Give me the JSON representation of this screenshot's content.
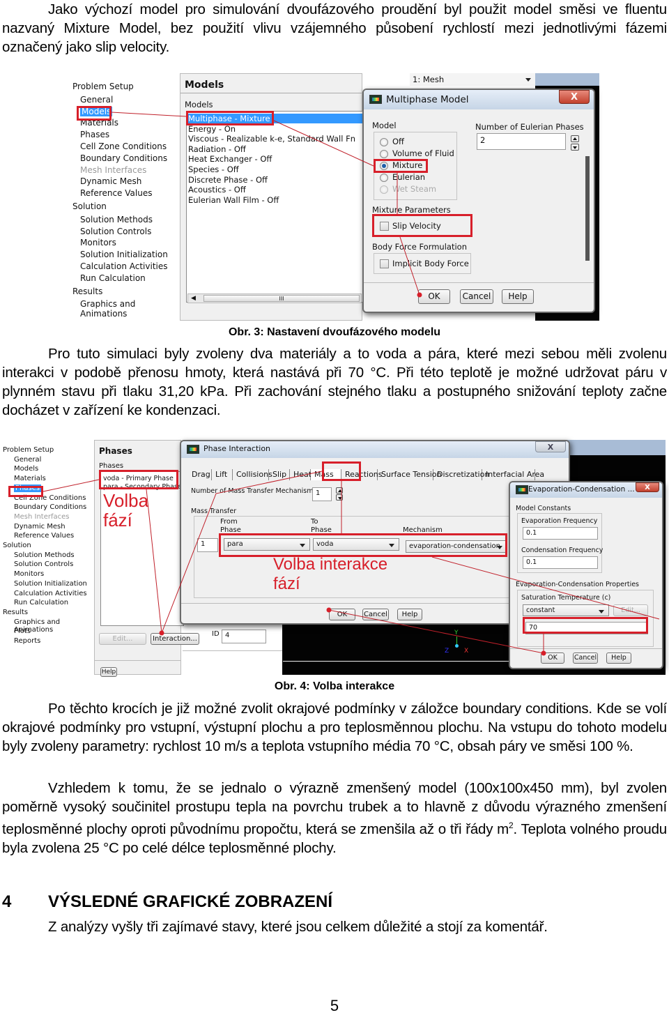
{
  "paragraphs": {
    "p1": "Jako výchozí model pro simulování dvoufázového proudění byl použit model směsi ve fluentu nazvaný Mixture Model, bez použití vlivu vzájemného působení rychlostí mezi jednotlivými fázemi označený jako slip velocity.",
    "p2": "Pro tuto simulaci byly zvoleny dva materiály a to voda a pára, které mezi sebou měli zvolenu interakci v podobě přenosu hmoty, která nastává při 70 °C. Při této teplotě je možné udržovat páru v plynném stavu při tlaku 31,20 kPa. Při zachování stejného tlaku a postupného snižování teploty začne docházet v zařízení ke kondenzaci.",
    "p3": "Po těchto krocích je již možné zvolit okrajové podmínky v záložce boundary conditions. Kde se volí okrajové podmínky pro vstupní, výstupní plochu a pro teplosměnnou plochu. Na vstupu do tohoto modelu byly zvoleny parametry: rychlost 10 m/s a teplota vstupního média 70 °C, obsah páry ve směsi 100 %.",
    "p4_before_sup": "Vzhledem k tomu, že se jednalo o výrazně zmenšený model (100x100x450 mm), byl zvolen poměrně vysoký součinitel prostupu tepla na povrchu trubek a to hlavně z důvodu výrazného zmenšení teplosměnné plochy oproti původnímu propočtu, která se zmenšila až o tři řády m",
    "p4_sup": "2",
    "p4_after_sup": ". Teplota volného proudu byla zvolena 25 °C po celé délce teplosměnné plochy.",
    "p5": "Z analýzy vyšly tři zajímavé stavy, které jsou celkem důležité a stojí za komentář."
  },
  "captions": {
    "fig3": "Obr. 3: Nastavení dvoufázového modelu",
    "fig4": "Obr. 4: Volba interakce"
  },
  "heading": {
    "number": "4",
    "title": "VÝSLEDNÉ GRAFICKÉ ZOBRAZENÍ"
  },
  "page_number": "5",
  "annotation_color": "#d71f2a",
  "figure3": {
    "tree": {
      "groups": [
        {
          "label": "Problem Setup",
          "items": [
            "General",
            "Models",
            "Materials",
            "Phases",
            "Cell Zone Conditions",
            "Boundary Conditions",
            "Mesh Interfaces",
            "Dynamic Mesh",
            "Reference Values"
          ]
        },
        {
          "label": "Solution",
          "items": [
            "Solution Methods",
            "Solution Controls",
            "Monitors",
            "Solution Initialization",
            "Calculation Activities",
            "Run Calculation"
          ]
        },
        {
          "label": "Results",
          "items": [
            "Graphics and Animations"
          ]
        }
      ],
      "selected": "Models",
      "disabled": [
        "Mesh Interfaces"
      ]
    },
    "models_panel": {
      "title": "Models",
      "list_label": "Models",
      "items": [
        "Multiphase - Mixture",
        "Energy - On",
        "Viscous - Realizable k-e, Standard Wall Fn",
        "Radiation - Off",
        "Heat Exchanger - Off",
        "Species - Off",
        "Discrete Phase - Off",
        "Acoustics - Off",
        "Eulerian Wall Film - Off"
      ],
      "scrollbar_grip": "III"
    },
    "mesh_selector": "1: Mesh",
    "multiphase_dialog": {
      "title": "Multiphase Model",
      "close": "X",
      "model_label": "Model",
      "options": [
        "Off",
        "Volume of Fluid",
        "Mixture",
        "Eulerian",
        "Wet Steam"
      ],
      "selected": "Mixture",
      "disabled": [
        "Wet Steam"
      ],
      "phases_label": "Number of Eulerian Phases",
      "phases_value": "2",
      "mixture_params_label": "Mixture Parameters",
      "slip_velocity": "Slip Velocity",
      "body_force_label": "Body Force Formulation",
      "implicit_body_force": "Implicit Body Force",
      "ok": "OK",
      "cancel": "Cancel",
      "help": "Help"
    }
  },
  "figure4": {
    "tree": {
      "groups": [
        {
          "label": "Problem Setup",
          "items": [
            "General",
            "Models",
            "Materials",
            "Phases",
            "Cell Zone Conditions",
            "Boundary Conditions",
            "Mesh Interfaces",
            "Dynamic Mesh",
            "Reference Values"
          ]
        },
        {
          "label": "Solution",
          "items": [
            "Solution Methods",
            "Solution Controls",
            "Monitors",
            "Solution Initialization",
            "Calculation Activities",
            "Run Calculation"
          ]
        },
        {
          "label": "Results",
          "items": [
            "Graphics and Animations",
            "Plots",
            "Reports"
          ]
        }
      ],
      "selected": "Phases",
      "disabled": [
        "Mesh Interfaces"
      ]
    },
    "phases_panel": {
      "title": "Phases",
      "list_label": "Phases",
      "items": [
        "voda - Primary Phase",
        "para - Secondary Phase"
      ],
      "annotation": "Volba\nfází",
      "edit": "Edit...",
      "interaction": "Interaction...",
      "id_label": "ID",
      "id_value": "4",
      "help": "Help"
    },
    "interaction_dialog": {
      "title": "Phase Interaction",
      "close": "X",
      "tabs": [
        "Drag",
        "Lift",
        "Collisions",
        "Slip",
        "Heat",
        "Mass",
        "Reactions",
        "Surface Tension",
        "Discretization",
        "Interfacial Area"
      ],
      "active_tab": "Mass",
      "num_mechanisms_label": "Number of Mass Transfer Mechanisms",
      "num_mechanisms_value": "1",
      "mass_transfer_label": "Mass Transfer",
      "col_from": "From\nPhase",
      "col_to": "To\nPhase",
      "col_mechanism": "Mechanism",
      "row_index": "1",
      "from_value": "para",
      "to_value": "voda",
      "mechanism_value": "evaporation-condensation",
      "annotation": "Volba interakce\nfází",
      "ok": "OK",
      "cancel": "Cancel",
      "help": "Help"
    },
    "evap_dialog": {
      "title": "Evaporation-Condensation ...",
      "close": "X",
      "constants_label": "Model Constants",
      "evap_freq_label": "Evaporation Frequency",
      "evap_freq_value": "0.1",
      "cond_freq_label": "Condensation Frequency",
      "cond_freq_value": "0.1",
      "props_label": "Evaporation-Condensation Properties",
      "sat_temp_label": "Saturation Temperature (c)",
      "sat_temp_method": "constant",
      "edit": "Edit...",
      "sat_temp_value": "70",
      "ok": "OK",
      "cancel": "Cancel",
      "help": "Help"
    },
    "axes": {
      "y": "Y",
      "x": "X",
      "z": "Z"
    }
  }
}
